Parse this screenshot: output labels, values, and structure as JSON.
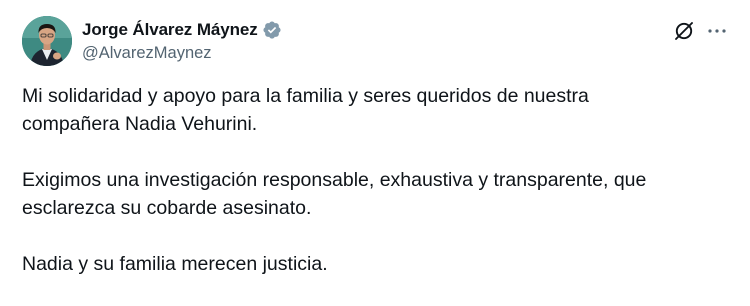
{
  "author": {
    "display_name": "Jorge Álvarez Máynez",
    "handle": "@AlvarezMaynez",
    "verified_icon": "verified-badge-icon",
    "verified_color": "#829aab",
    "avatar_icon": "profile-photo"
  },
  "actions": {
    "grok_icon": "grok-icon",
    "more_icon": "more-options-icon"
  },
  "post": {
    "paragraphs": [
      {
        "lines": [
          "Mi solidaridad y apoyo para la familia y seres queridos de nuestra",
          "compañera Nadia Vehurini."
        ]
      },
      {
        "lines": [
          "Exigimos una investigación responsable, exhaustiva y transparente, que",
          "esclarezca su cobarde asesinato."
        ]
      },
      {
        "lines": [
          "Nadia y su familia merecen justicia."
        ]
      }
    ]
  }
}
